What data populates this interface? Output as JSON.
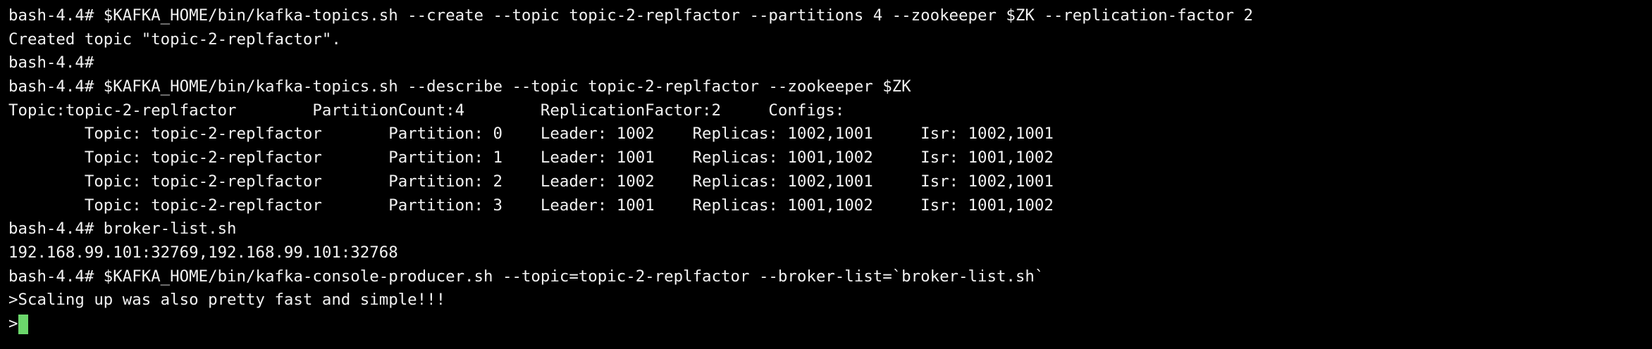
{
  "terminal": {
    "prompt_last": ">",
    "cursor_color": "#6bd66b",
    "lines": [
      "bash-4.4# $KAFKA_HOME/bin/kafka-topics.sh --create --topic topic-2-replfactor --partitions 4 --zookeeper $ZK --replication-factor 2",
      "Created topic \"topic-2-replfactor\".",
      "bash-4.4#",
      "bash-4.4# $KAFKA_HOME/bin/kafka-topics.sh --describe --topic topic-2-replfactor --zookeeper $ZK",
      "Topic:topic-2-replfactor        PartitionCount:4        ReplicationFactor:2     Configs:",
      "        Topic: topic-2-replfactor       Partition: 0    Leader: 1002    Replicas: 1002,1001     Isr: 1002,1001",
      "        Topic: topic-2-replfactor       Partition: 1    Leader: 1001    Replicas: 1001,1002     Isr: 1001,1002",
      "        Topic: topic-2-replfactor       Partition: 2    Leader: 1002    Replicas: 1002,1001     Isr: 1002,1001",
      "        Topic: topic-2-replfactor       Partition: 3    Leader: 1001    Replicas: 1001,1002     Isr: 1001,1002",
      "bash-4.4# broker-list.sh",
      "192.168.99.101:32769,192.168.99.101:32768",
      "bash-4.4# $KAFKA_HOME/bin/kafka-console-producer.sh --topic=topic-2-replfactor --broker-list=`broker-list.sh`",
      ">Scaling up was also pretty fast and simple!!!"
    ]
  }
}
